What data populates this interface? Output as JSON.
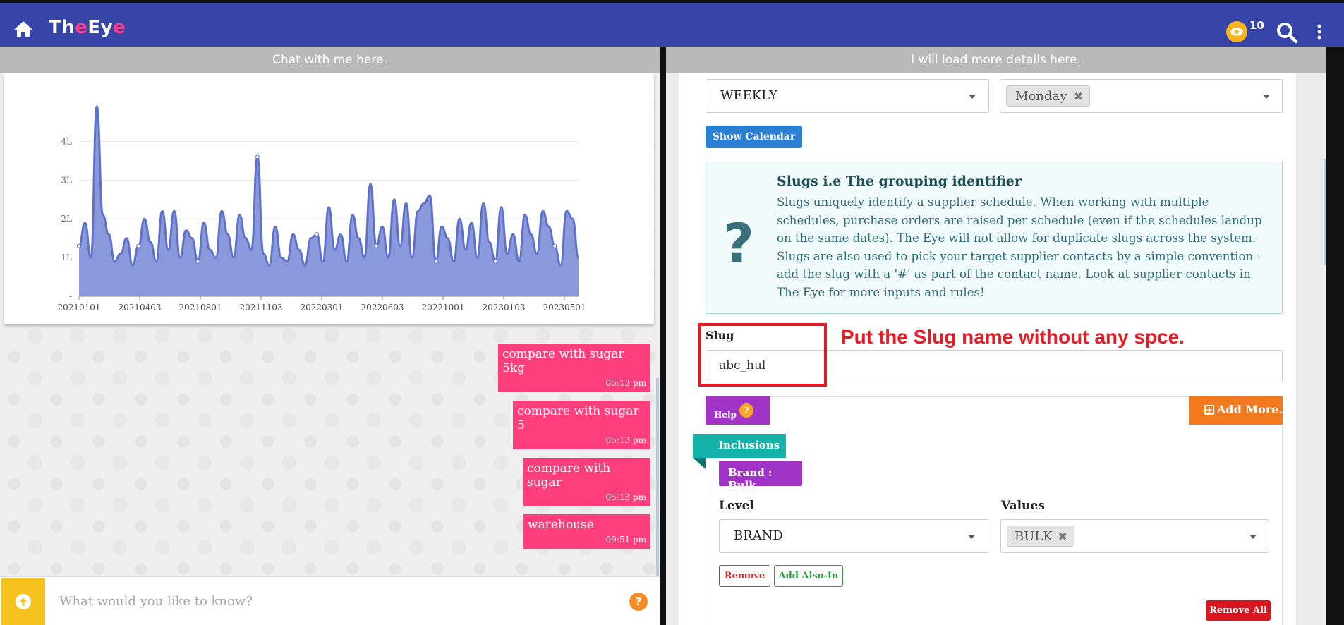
{
  "app": {
    "brand_part1": "Th",
    "brand_e1": "e",
    "brand_part2": "Ey",
    "brand_e2": "e",
    "notification_count": "10",
    "accent_color": "#3745a8",
    "icons": [
      "home-icon",
      "eye-icon",
      "search-icon",
      "kebab-menu-icon"
    ]
  },
  "left_panel": {
    "header": "Chat with me here.",
    "chat_input_placeholder": "What would you like to know?",
    "help_glyph": "?",
    "messages": [
      {
        "text": "compare with sugar 5kg",
        "time": "05:13 pm"
      },
      {
        "text": "compare with sugar 5",
        "time": "05:13 pm"
      },
      {
        "text": "compare with sugar",
        "time": "05:13 pm"
      },
      {
        "text": "warehouse",
        "time": "09:51 pm"
      }
    ]
  },
  "chart_data": {
    "type": "area",
    "title": "",
    "xlabel": "",
    "ylabel": "",
    "ylim": [
      0,
      4.9
    ],
    "y_ticks": [
      "-",
      "1L",
      "2L",
      "3L",
      "4L"
    ],
    "x_ticks": [
      "20210101",
      "20210403",
      "20210801",
      "20211103",
      "20220301",
      "20220603",
      "20221001",
      "20230103",
      "20230501"
    ],
    "grid": true,
    "color": "#5f72c9",
    "values": [
      1.3,
      1.9,
      1.0,
      4.9,
      2.1,
      1.6,
      0.9,
      1.1,
      1.5,
      0.8,
      1.3,
      2.0,
      1.4,
      0.9,
      2.2,
      1.2,
      2.2,
      1.0,
      1.7,
      1.5,
      0.9,
      1.9,
      1.2,
      1.0,
      2.2,
      1.6,
      1.0,
      2.1,
      1.5,
      1.2,
      3.6,
      1.1,
      0.8,
      1.8,
      1.0,
      0.9,
      1.6,
      1.2,
      0.8,
      1.5,
      1.6,
      0.9,
      2.3,
      1.2,
      1.6,
      0.9,
      2.1,
      1.5,
      1.0,
      2.9,
      1.3,
      1.8,
      1.0,
      2.5,
      1.3,
      2.4,
      1.0,
      2.2,
      2.4,
      2.6,
      0.9,
      1.8,
      1.5,
      0.9,
      2.0,
      1.2,
      1.9,
      1.0,
      2.4,
      1.4,
      0.9,
      2.3,
      1.1,
      1.6,
      0.9,
      2.1,
      1.6,
      1.1,
      2.2,
      1.8,
      1.3,
      0.8,
      2.2,
      2.0,
      1.0
    ]
  },
  "right_panel": {
    "header": "I will load more details here.",
    "frequency_value": "WEEKLY",
    "day_chip": "Monday",
    "chip_remove_glyph": "✖",
    "show_calendar_label": "Show Calendar",
    "info_glyph": "?",
    "info_title": "Slugs i.e The grouping identifier",
    "info_body": "Slugs uniquely identify a supplier schedule. When working with multiple schedules, purchase orders are raised per schedule (even if the schedules landup on the same dates). The Eye will not allow for duplicate slugs across the system. Slugs are also used to pick your target supplier contacts by a simple convention - add the slug with a '#' as part of the contact name. Look at supplier contacts in The Eye for more inputs and rules!",
    "slug_label": "Slug",
    "slug_value": "abc_hul",
    "annotation": "Put the Slug name without any spce.",
    "help_label": "Help",
    "help_glyph": "?",
    "add_more_label": "Add More.",
    "add_more_glyph": "+",
    "inclusions_label": "Inclusions",
    "brand_chip": "Brand : Bulk",
    "level_label": "Level",
    "level_value": "BRAND",
    "values_label": "Values",
    "values_chip": "BULK",
    "remove_label": "Remove",
    "add_also_in_label": "Add Also-In",
    "remove_all_label": "Remove All",
    "colors": {
      "help": "#a233c7",
      "add_more": "#f37a1f",
      "inclusions": "#14b2a8",
      "annotation": "#e21d27",
      "remove_all": "#d9161f"
    }
  }
}
